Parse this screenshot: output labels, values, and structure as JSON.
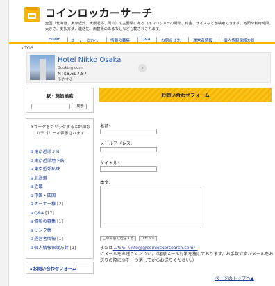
{
  "header": {
    "title": "コインロッカーサーチ",
    "description": "全国（北海道、東京近郊、大阪近郊、岡山）の主要駅にあるコインロッカーの場所、料金、サイズなどが検索できます。地図や利用時間、大きさ、支払方法、連絡先、両替機のあるなしなども載されされます。"
  },
  "nav": {
    "items": [
      "HOME",
      "オーナーの方へ",
      "情報の募集",
      "Q&A",
      "お問合せ先",
      "運営者情報",
      "個人情報保護方針"
    ]
  },
  "breadcrumb": "› TOP",
  "ad": {
    "title": "Hotel Nikko Osaka",
    "source": "Booking.com",
    "price": "NT$8,697.87",
    "subtext": "予約する",
    "arrow": "›"
  },
  "sidebar": {
    "search": {
      "heading": "駅・施設検索",
      "button_label": "検索",
      "input_value": ""
    },
    "categories": {
      "note": "※マークをクリックすると詳細なカテゴリーが表示されます",
      "items": [
        {
          "label": "東京近郊ＪＲ",
          "count": ""
        },
        {
          "label": "東京近郊地下鉄",
          "count": ""
        },
        {
          "label": "東京近郊私鉄",
          "count": ""
        },
        {
          "label": "北海道",
          "count": ""
        },
        {
          "label": "近畿",
          "count": ""
        },
        {
          "label": "中国・四国",
          "count": ""
        },
        {
          "label": "オーナー様",
          "count": "[2]"
        },
        {
          "label": "Q&A",
          "count": "[17]"
        },
        {
          "label": "情報の募集",
          "count": "[1]"
        },
        {
          "label": "リンク集",
          "count": ""
        },
        {
          "label": "運営者情報",
          "count": "[1]"
        },
        {
          "label": "個人情報保護方針",
          "count": "[1]"
        }
      ]
    },
    "contact": {
      "label": "お問い合わせフォーム"
    }
  },
  "form": {
    "title": "お問い合わせフォーム",
    "name_label": "名前:",
    "email_label": "メールアドレス:",
    "subject_label": "タイトル:",
    "body_label": "本文:",
    "name_value": "",
    "email_value": "",
    "subject_value": "",
    "body_value": "",
    "submit_label": "この内容で送信する",
    "reset_label": "リセット"
  },
  "note": {
    "prefix": "または",
    "link": "こちら（info@@coinlockersearch.com）",
    "text": "にメールをお送りください。（迷惑メール対策を施しております。お手数ですがメールをお送りの際に@を一つ消してからお送りください。）"
  },
  "footer": {
    "top_link": "ページのトップへ▲"
  }
}
